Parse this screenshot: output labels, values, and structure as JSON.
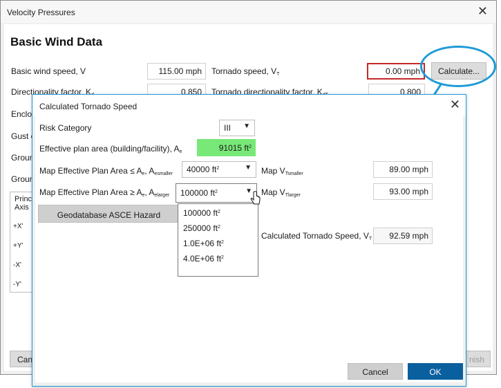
{
  "main_window": {
    "title": "Velocity Pressures",
    "section_title": "Basic Wind Data",
    "basic_wind_speed": {
      "label": "Basic wind speed, V",
      "value": "115.00 mph"
    },
    "tornado_speed": {
      "label_main": "Tornado speed, V",
      "label_sub": "T",
      "value": "0.00 mph"
    },
    "calculate_label": "Calculate...",
    "directionality": {
      "label_main": "Directionality factor, K",
      "label_sub": "d",
      "value": "0.850"
    },
    "tornado_directionality": {
      "label_main": "Tornado directionality factor, K",
      "label_sub": "dT",
      "value": "0.800"
    },
    "partial_labels": [
      "Enclos",
      "Gust e",
      "Groun",
      "Groun"
    ],
    "grid": {
      "header_line1": "Princ",
      "header_line2": "Axis",
      "rows": [
        "+X'",
        "+Y'",
        "-X'",
        "-Y'"
      ]
    },
    "cancel_partial": "Can",
    "finish_partial": "nish"
  },
  "dialog": {
    "title": "Calculated Tornado Speed",
    "risk_category": {
      "label": "Risk Category",
      "value": "III"
    },
    "effective_plan_area": {
      "label_main": "Effective plan area (building/facility), A",
      "label_sub": "e",
      "value": "91015 ft",
      "value_sup": "2"
    },
    "map_smaller": {
      "label_prefix": "Map Effective Plan Area ≤ A",
      "label_sub1": "e",
      "label_mid": ", A",
      "label_sub2": "esmaller",
      "value": "40000 ft",
      "value_sup": "2"
    },
    "map_larger": {
      "label_prefix": "Map Effective Plan Area ≥ A",
      "label_sub1": "e",
      "label_mid": ", A",
      "label_sub2": "elarger",
      "value": "100000 ft",
      "value_sup": "2"
    },
    "dropdown_options": [
      {
        "value": "100000 ft",
        "sup": "2"
      },
      {
        "value": "250000 ft",
        "sup": "2"
      },
      {
        "value": "1.0E+06 ft",
        "sup": "2"
      },
      {
        "value": "4.0E+06 ft",
        "sup": "2"
      }
    ],
    "map_v_smaller": {
      "label_main": "Map V",
      "label_sub": "Tsmaller",
      "value": "89.00 mph"
    },
    "map_v_larger": {
      "label_main": "Map V",
      "label_sub": "Tlarger",
      "value": "93.00 mph"
    },
    "geodatabase_label": "Geodatabase ASCE Hazard",
    "calculated_tornado_speed": {
      "label_main": "Calculated Tornado Speed, V",
      "label_sub": "T",
      "value": "92.59 mph"
    },
    "cancel_label": "Cancel",
    "ok_label": "OK"
  },
  "colors": {
    "accent_blue": "#1d9ad6",
    "ok_button": "#0a5f9e",
    "error_border": "#c62828",
    "highlight_green": "#78e878"
  }
}
